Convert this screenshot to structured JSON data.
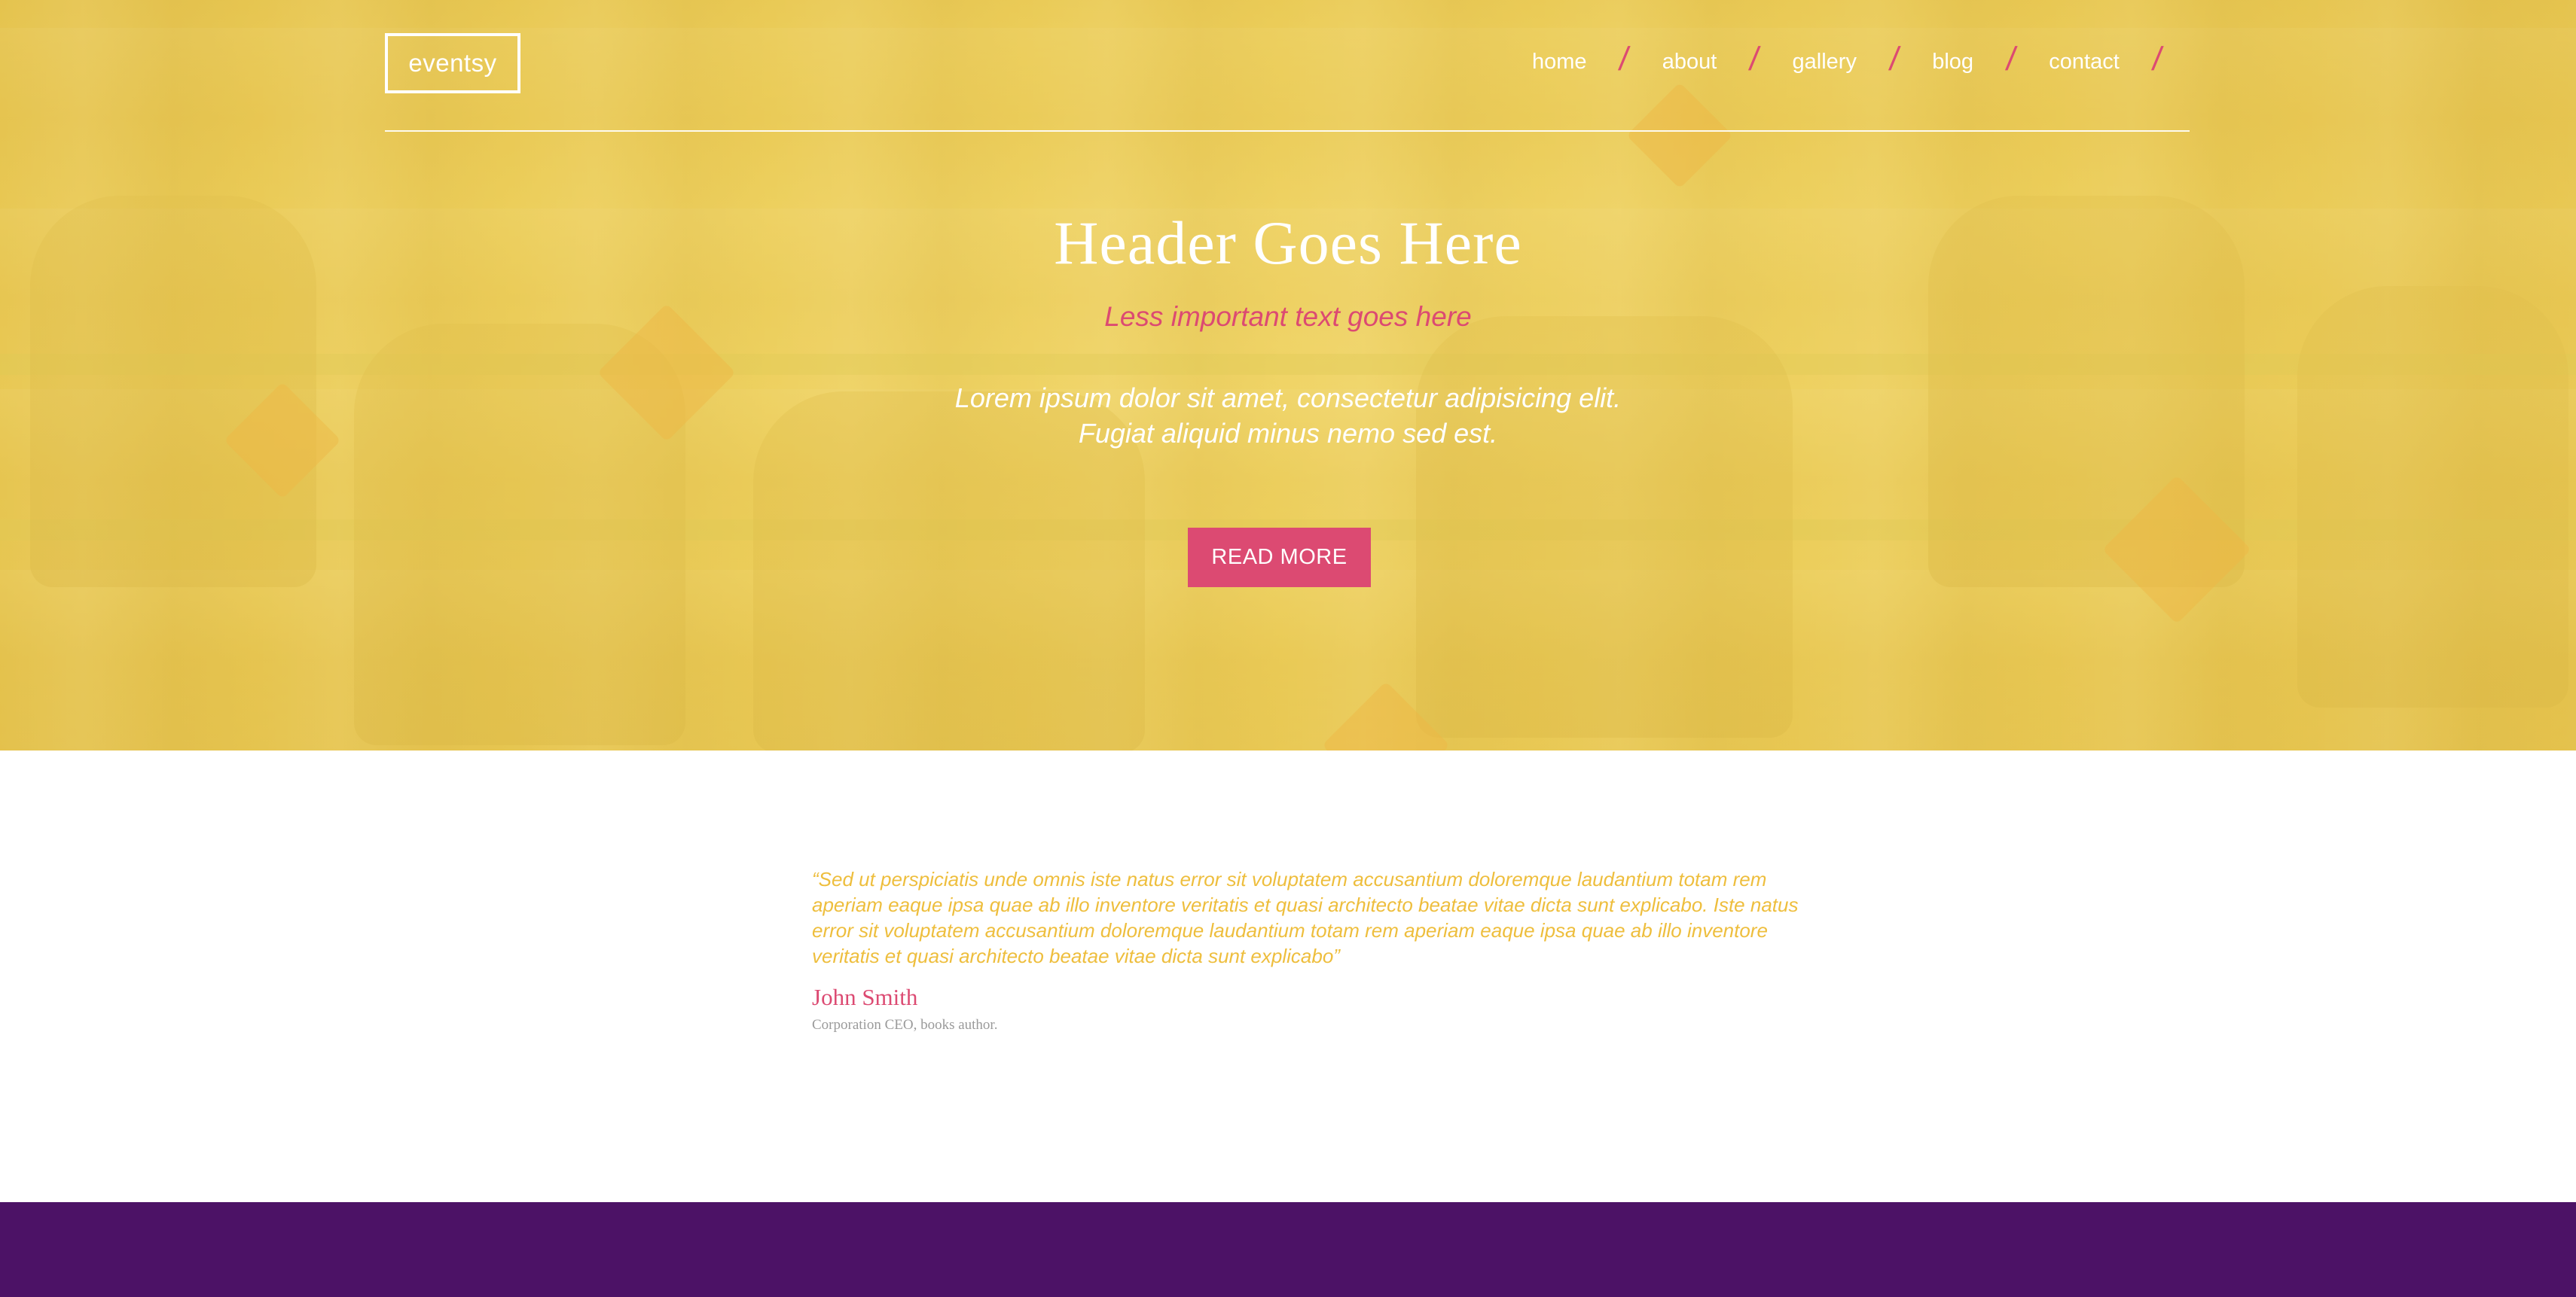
{
  "brand": {
    "logo_text": "eventsy"
  },
  "nav": {
    "items": [
      {
        "label": "home"
      },
      {
        "label": "about"
      },
      {
        "label": "gallery"
      },
      {
        "label": "blog"
      },
      {
        "label": "contact"
      }
    ],
    "separator": "/"
  },
  "hero": {
    "title": "Header Goes Here",
    "subtitle": "Less important text goes here",
    "body": "Lorem ipsum dolor sit amet, consectetur adipisicing elit. Fugiat aliquid minus nemo sed est.",
    "cta_label": "READ MORE"
  },
  "testimonial": {
    "quote": "“Sed ut perspiciatis unde omnis iste natus error sit voluptatem accusantium doloremque laudantium totam rem aperiam eaque ipsa quae ab illo inventore veritatis et quasi architecto beatae vitae dicta sunt explicabo. Iste natus error sit voluptatem accusantium doloremque laudantium totam rem aperiam eaque ipsa quae ab illo inventore veritatis et quasi architecto beatae vitae dicta sunt explicabo”",
    "author": "John Smith",
    "role": "Corporation CEO, books author."
  },
  "colors": {
    "accent_pink": "#dc4a72",
    "hero_yellow": "#ebcd5c",
    "quote_yellow": "#eebe3d",
    "footer_purple": "#4c1266"
  }
}
